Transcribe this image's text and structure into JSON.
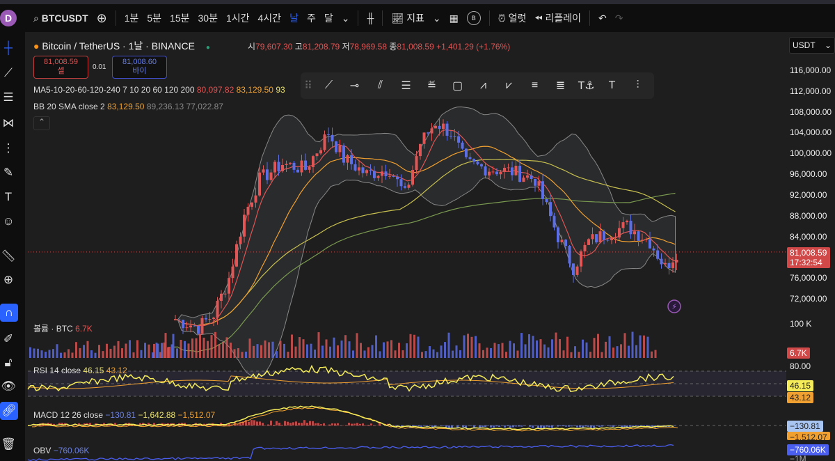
{
  "topbar": {
    "avatar": "D",
    "symbol": "BTCUSDT",
    "intervals": [
      "1분",
      "5분",
      "15분",
      "30분",
      "1시간",
      "4시간",
      "날",
      "주",
      "달"
    ],
    "active_interval": "날",
    "indicators": "지표",
    "alert": "얼럿",
    "replay": "리플레이",
    "badge": "B"
  },
  "symbol_info": {
    "title": "Bitcoin / TetherUS · 1날 · BINANCE",
    "o_label": "시",
    "o": "79,607.30",
    "h_label": "고",
    "h": "81,208.79",
    "l_label": "저",
    "l": "78,969.58",
    "c_label": "종",
    "c": "81,008.59",
    "change": "+1,401.29 (+1.76%)"
  },
  "trade": {
    "sell_price": "81,008.59",
    "sell_label": "셀",
    "spread": "0.01",
    "buy_price": "81,008.60",
    "buy_label": "바이"
  },
  "indicators": {
    "ma": {
      "label": "MA5-10-20-60-120-240 7 10 20 60 120 200",
      "v1": "80,097.82",
      "v2": "83,129.50",
      "v3": "93"
    },
    "bb": {
      "label": "BB 20 SMA close 2",
      "basis": "83,129.50",
      "upper": "89,236.13",
      "lower": "77,022.87"
    },
    "volume": {
      "label": "볼륨 · BTC",
      "value": "6.7K",
      "axis": "100 K"
    },
    "rsi": {
      "label": "RSI 14 close",
      "value": "46.15",
      "ma": "43.12",
      "axis": "80.00"
    },
    "macd": {
      "label": "MACD 12 26 close",
      "hist": "−130.81",
      "macd": "−1,642.88",
      "signal": "−1,512.07"
    },
    "obv": {
      "label": "OBV",
      "value": "−760.06K",
      "axis": "−1M"
    }
  },
  "currency": "USDT",
  "price_axis": [
    "116,000.00",
    "112,000.00",
    "108,000.00",
    "104,000.00",
    "100,000.00",
    "96,000.00",
    "92,000.00",
    "88,000.00",
    "84,000.00",
    "76,000.00",
    "72,000.00"
  ],
  "last_price": {
    "price": "81,008.59",
    "countdown": "17:32:54"
  },
  "colors": {
    "up": "#e05555",
    "down": "#5b6ee8",
    "accent": "#2962ff",
    "rsi": "#f5ec5a",
    "ma": "#f0a030"
  },
  "chart_data": {
    "type": "candlestick",
    "y_range": [
      70000,
      118000
    ],
    "close_path": [
      [
        0,
        68000
      ],
      [
        6,
        66500
      ],
      [
        10,
        69000
      ],
      [
        14,
        76000
      ],
      [
        18,
        88000
      ],
      [
        22,
        95000
      ],
      [
        28,
        98000
      ],
      [
        34,
        97000
      ],
      [
        40,
        104000
      ],
      [
        44,
        99000
      ],
      [
        50,
        96000
      ],
      [
        56,
        97000
      ],
      [
        60,
        92000
      ],
      [
        64,
        102000
      ],
      [
        68,
        106000
      ],
      [
        72,
        104000
      ],
      [
        76,
        98000
      ],
      [
        82,
        97000
      ],
      [
        88,
        96500
      ],
      [
        94,
        95000
      ],
      [
        100,
        84000
      ],
      [
        104,
        78000
      ],
      [
        108,
        83000
      ],
      [
        114,
        85000
      ],
      [
        118,
        86000
      ],
      [
        124,
        83000
      ],
      [
        128,
        78000
      ],
      [
        131,
        81000
      ]
    ]
  }
}
